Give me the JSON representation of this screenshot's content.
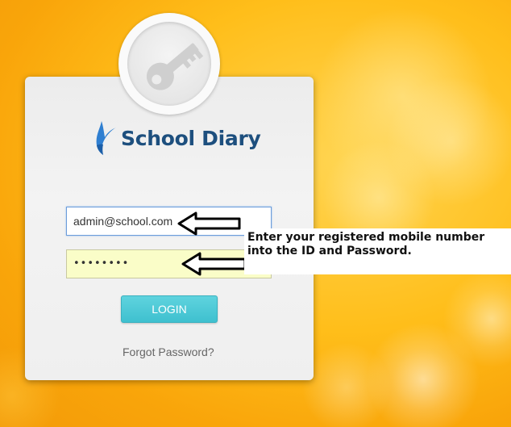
{
  "logo": {
    "text": "School Diary",
    "icon": "y-swoosh-logo-icon",
    "color": "#1d4f7e"
  },
  "key_icon": "key-icon",
  "form": {
    "email_value": "admin@school.com",
    "password_value": "••••••••",
    "login_label": "LOGIN",
    "forgot_label": "Forgot Password?"
  },
  "annotation": {
    "text_line1": "Enter your registered mobile number",
    "text_line2": "into the ID and Password.",
    "arrow_icon": "left-arrow-icon"
  },
  "colors": {
    "background": "#fbb012",
    "login_button": "#4cc8d6",
    "password_field_bg": "#fafdc8"
  }
}
